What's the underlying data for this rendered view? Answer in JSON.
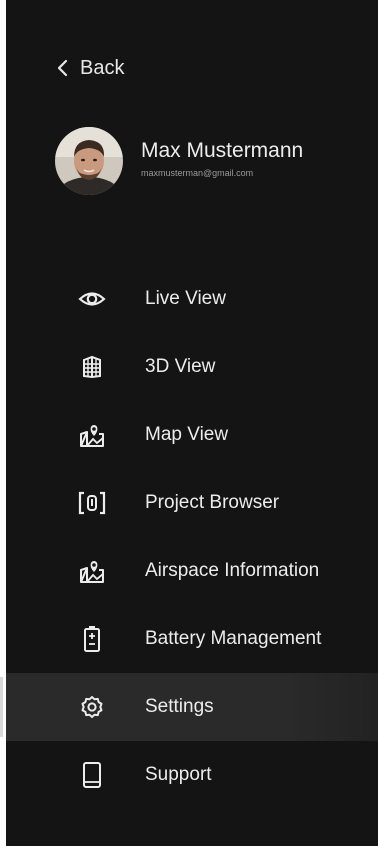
{
  "nav": {
    "back_label": "Back"
  },
  "profile": {
    "name": "Max Mustermann",
    "email": "maxmusterman@gmail.com"
  },
  "menu": {
    "items": [
      {
        "label": "Live View",
        "icon": "eye-icon"
      },
      {
        "label": "3D View",
        "icon": "building-3d-icon"
      },
      {
        "label": "Map View",
        "icon": "map-pin-icon"
      },
      {
        "label": "Project Browser",
        "icon": "folder-icon"
      },
      {
        "label": "Airspace Information",
        "icon": "map-pin-icon"
      },
      {
        "label": "Battery Management",
        "icon": "battery-icon"
      },
      {
        "label": "Settings",
        "icon": "gear-icon"
      },
      {
        "label": "Support",
        "icon": "tablet-icon"
      }
    ],
    "active_index": 6
  },
  "colors": {
    "background": "#141414",
    "text": "#ececec",
    "active_row": "#2a2a2a",
    "active_indicator": "#d8d8d8"
  }
}
